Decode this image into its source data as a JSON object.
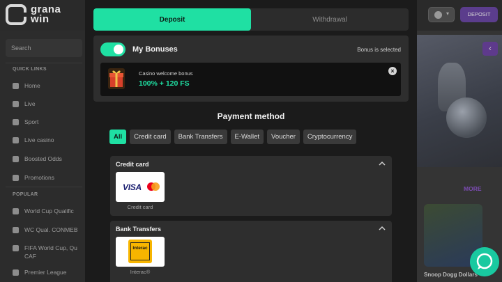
{
  "site": {
    "logo_line1": "grana",
    "logo_line2": "win",
    "search_placeholder": "Search",
    "quick_links_heading": "QUICK LINKS",
    "quick_links": [
      "Home",
      "Live",
      "Sport",
      "Live casino",
      "Boosted Odds",
      "Promotions"
    ],
    "popular_heading": "POPULAR",
    "popular": [
      "World Cup Qualific",
      "WC Qual. CONMEB",
      "FIFA World Cup, Qu",
      "CAF",
      "Premier League"
    ],
    "header_deposit": "DEPOSIT",
    "more": "MORE",
    "game_title": "Snoop Dogg Dollars"
  },
  "modal": {
    "tabs": {
      "deposit": "Deposit",
      "withdrawal": "Withdrawal"
    },
    "bonus": {
      "title": "My Bonuses",
      "status": "Bonus is selected",
      "name": "Casino welcome bonus",
      "value": "100% + 120 FS"
    },
    "payment_heading": "Payment method",
    "filters": [
      "All",
      "Credit card",
      "Bank Transfers",
      "E-Wallet",
      "Voucher",
      "Cryptocurrency"
    ],
    "sections": [
      {
        "title": "Credit card",
        "method_label": "Credit card",
        "logo_text": "VISA"
      },
      {
        "title": "Bank Transfers",
        "method_label": "Interac®",
        "logo_text": "Interac"
      }
    ]
  },
  "colors": {
    "accent": "#1fe0a3",
    "modal_bg": "#1b1b1b",
    "panel_bg": "#2e2e2e",
    "brand_purple": "#5b3d8c"
  },
  "icons": [
    "gift-icon",
    "close-icon",
    "chevron-up-icon",
    "chat-icon",
    "user-icon",
    "mastercard-icon"
  ]
}
